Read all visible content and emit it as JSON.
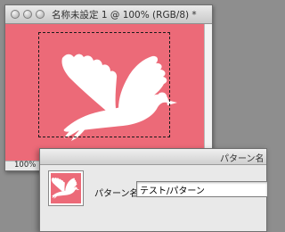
{
  "document_window": {
    "title": "名称未設定 1 @ 100% (RGB/8) *",
    "zoom": "100%",
    "canvas_color": "#ec6a78"
  },
  "pattern_dialog": {
    "title": "パターン名",
    "name_label": "パターン名：",
    "name_value": "テスト/パターン",
    "thumbnail_icon": "dove-icon"
  },
  "icons": {
    "canvas_graphic": "dove-icon"
  }
}
